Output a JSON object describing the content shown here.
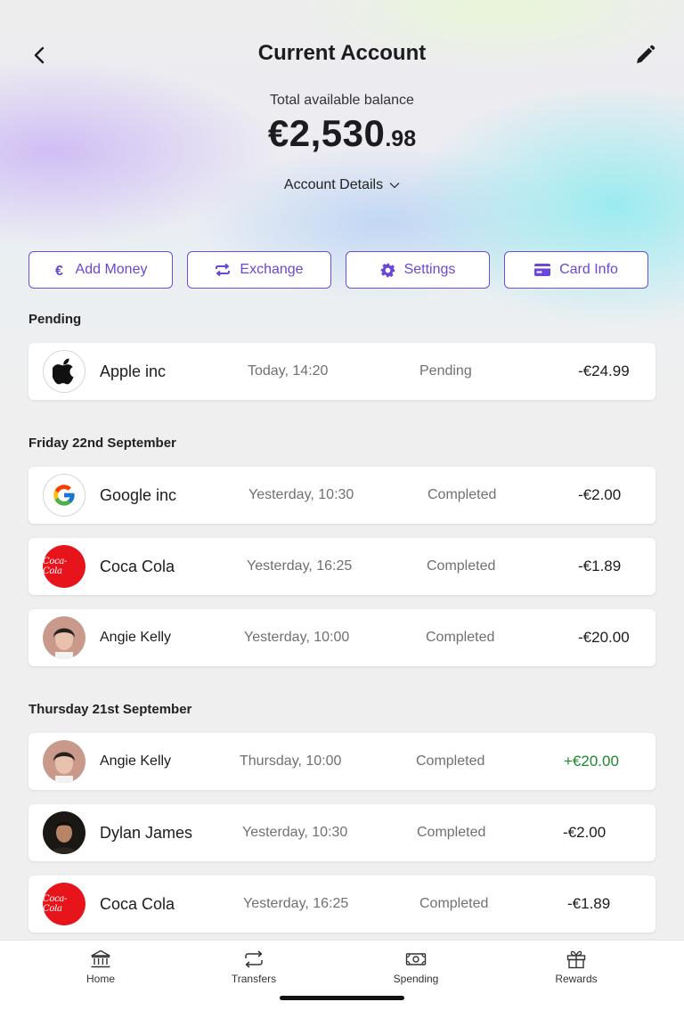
{
  "header": {
    "title": "Current Account",
    "balance_label": "Total available balance",
    "balance_main": "€2,530",
    "balance_decimals": ".98",
    "account_details_label": "Account Details"
  },
  "actions": [
    {
      "label": "Add Money",
      "icon": "euro-icon"
    },
    {
      "label": "Exchange",
      "icon": "exchange-icon"
    },
    {
      "label": "Settings",
      "icon": "gear-icon"
    },
    {
      "label": "Card Info",
      "icon": "card-icon"
    }
  ],
  "accent_color": "#6a47d6",
  "positive_color": "#1a8a2e",
  "sections": [
    {
      "title": "Pending",
      "transactions": [
        {
          "name": "Apple inc",
          "time": "Today, 14:20",
          "status": "Pending",
          "amount": "-€24.99",
          "avatar": "apple-logo"
        }
      ]
    },
    {
      "title": "Friday 22nd September",
      "transactions": [
        {
          "name": "Google inc",
          "time": "Yesterday, 10:30",
          "status": "Completed",
          "amount": "-€2.00",
          "avatar": "google-logo"
        },
        {
          "name": "Coca Cola",
          "time": "Yesterday, 16:25",
          "status": "Completed",
          "amount": "-€1.89",
          "avatar": "coca-cola-logo",
          "avatar_text": "Coca-Cola"
        },
        {
          "name": "Angie Kelly",
          "time": "Yesterday, 10:00",
          "status": "Completed",
          "amount": "-€20.00",
          "avatar": "person-avatar"
        }
      ]
    },
    {
      "title": "Thursday 21st September",
      "transactions": [
        {
          "name": "Angie Kelly",
          "time": "Thursday, 10:00",
          "status": "Completed",
          "amount": "+€20.00",
          "avatar": "person-avatar"
        },
        {
          "name": "Dylan James",
          "time": "Yesterday, 10:30",
          "status": "Completed",
          "amount": "-€2.00",
          "avatar": "person-avatar"
        },
        {
          "name": "Coca Cola",
          "time": "Yesterday, 16:25",
          "status": "Completed",
          "amount": "-€1.89",
          "avatar": "coca-cola-logo",
          "avatar_text": "Coca-Cola"
        }
      ]
    }
  ],
  "tabbar": [
    {
      "label": "Home",
      "icon": "bank-icon"
    },
    {
      "label": "Transfers",
      "icon": "transfers-icon"
    },
    {
      "label": "Spending",
      "icon": "cash-icon"
    },
    {
      "label": "Rewards",
      "icon": "gift-icon"
    }
  ]
}
